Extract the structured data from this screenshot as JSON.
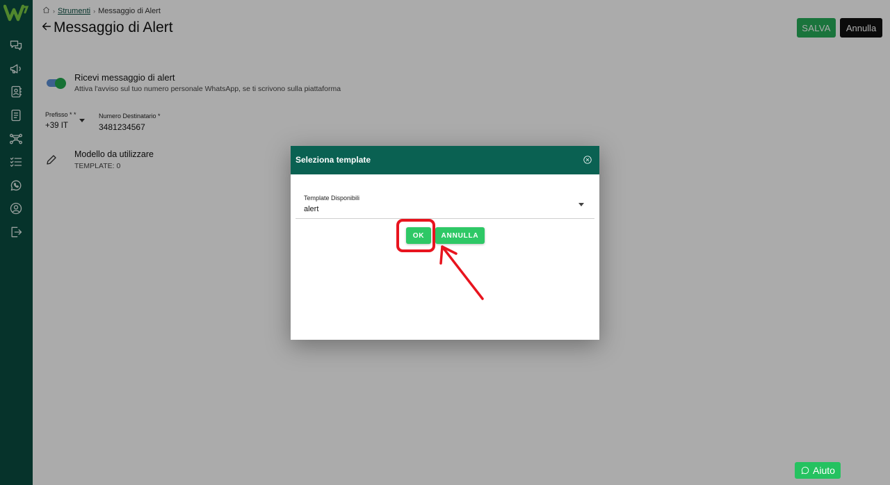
{
  "app": {
    "sidebar_icons": [
      "logo-icon",
      "chat-icon",
      "megaphone-icon",
      "contacts-icon",
      "document-icon",
      "flow-icon",
      "checklist-icon",
      "whatsapp-icon",
      "profile-icon",
      "logout-icon"
    ]
  },
  "breadcrumb": {
    "home_icon": "home-icon",
    "link": "Strumenti",
    "current": "Messaggio di Alert"
  },
  "header": {
    "title": "Messaggio di Alert",
    "save_label": "SALVA",
    "cancel_label": "Annulla"
  },
  "alert_setting": {
    "toggle_on": true,
    "title": "Ricevi messaggio di alert",
    "description": "Attiva l'avviso sul tuo numero personale WhatsApp, se ti scrivono sulla piattaforma"
  },
  "phone": {
    "prefix_label": "Prefisso * *",
    "prefix_value": "+39 IT",
    "number_label": "Numero Destinatario *",
    "number_value": "3481234567"
  },
  "model": {
    "title": "Modello da utilizzare",
    "count": "TEMPLATE: 0"
  },
  "help": {
    "label": "Aiuto"
  },
  "dialog": {
    "title": "Seleziona template",
    "select_label": "Template Disponibili",
    "select_value": "alert",
    "ok_label": "OK",
    "cancel_label": "ANNULLA"
  },
  "colors": {
    "sidebar": "#0a4d40",
    "dialog_header": "#0a6152",
    "primary_green": "#2ec866",
    "annotation_red": "#e8141e"
  }
}
